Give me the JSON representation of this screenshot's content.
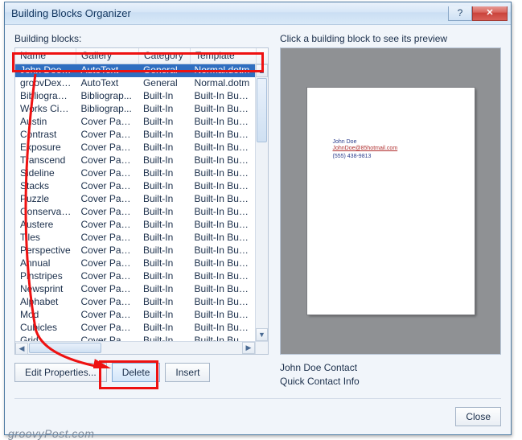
{
  "window": {
    "title": "Building Blocks Organizer",
    "label_left": "Building blocks:",
    "label_right": "Click a building block to see its preview"
  },
  "table": {
    "columns": [
      "Name",
      "Gallery",
      "Category",
      "Template"
    ],
    "rows": [
      {
        "name": "John Doe C...",
        "gallery": "AutoText",
        "category": "General",
        "template": "Normal.dotm",
        "selected": true
      },
      {
        "name": "groovDexter",
        "gallery": "AutoText",
        "category": "General",
        "template": "Normal.dotm"
      },
      {
        "name": "Bibliography",
        "gallery": "Bibliograp...",
        "category": "Built-In",
        "template": "Built-In Buil..."
      },
      {
        "name": "Works Cited",
        "gallery": "Bibliograp...",
        "category": "Built-In",
        "template": "Built-In Buil..."
      },
      {
        "name": "Austin",
        "gallery": "Cover Pages",
        "category": "Built-In",
        "template": "Built-In Buil..."
      },
      {
        "name": "Contrast",
        "gallery": "Cover Pages",
        "category": "Built-In",
        "template": "Built-In Buil..."
      },
      {
        "name": "Exposure",
        "gallery": "Cover Pages",
        "category": "Built-In",
        "template": "Built-In Buil..."
      },
      {
        "name": "Transcend",
        "gallery": "Cover Pages",
        "category": "Built-In",
        "template": "Built-In Buil..."
      },
      {
        "name": "Sideline",
        "gallery": "Cover Pages",
        "category": "Built-In",
        "template": "Built-In Buil..."
      },
      {
        "name": "Stacks",
        "gallery": "Cover Pages",
        "category": "Built-In",
        "template": "Built-In Buil..."
      },
      {
        "name": "Puzzle",
        "gallery": "Cover Pages",
        "category": "Built-In",
        "template": "Built-In Buil..."
      },
      {
        "name": "Conservative",
        "gallery": "Cover Pages",
        "category": "Built-In",
        "template": "Built-In Buil..."
      },
      {
        "name": "Austere",
        "gallery": "Cover Pages",
        "category": "Built-In",
        "template": "Built-In Buil..."
      },
      {
        "name": "Tiles",
        "gallery": "Cover Pages",
        "category": "Built-In",
        "template": "Built-In Buil..."
      },
      {
        "name": "Perspective",
        "gallery": "Cover Pages",
        "category": "Built-In",
        "template": "Built-In Buil..."
      },
      {
        "name": "Annual",
        "gallery": "Cover Pages",
        "category": "Built-In",
        "template": "Built-In Buil..."
      },
      {
        "name": "Pinstripes",
        "gallery": "Cover Pages",
        "category": "Built-In",
        "template": "Built-In Buil..."
      },
      {
        "name": "Newsprint",
        "gallery": "Cover Pages",
        "category": "Built-In",
        "template": "Built-In Buil..."
      },
      {
        "name": "Alphabet",
        "gallery": "Cover Pages",
        "category": "Built-In",
        "template": "Built-In Buil..."
      },
      {
        "name": "Mod",
        "gallery": "Cover Pages",
        "category": "Built-In",
        "template": "Built-In Buil..."
      },
      {
        "name": "Cubicles",
        "gallery": "Cover Pages",
        "category": "Built-In",
        "template": "Built-In Buil..."
      },
      {
        "name": "Grid",
        "gallery": "Cover Pages",
        "category": "Built-In",
        "template": "Built-In Buil..."
      }
    ]
  },
  "buttons": {
    "edit_properties": "Edit Properties...",
    "delete": "Delete",
    "insert": "Insert",
    "close": "Close"
  },
  "preview": {
    "name": "John Doe",
    "mail": "JohnDoe@85hotmail.com",
    "phone": "(555) 438-9813",
    "meta_line1": "John Doe Contact",
    "meta_line2": "Quick Contact Info"
  },
  "watermark": "groovyPost.com"
}
